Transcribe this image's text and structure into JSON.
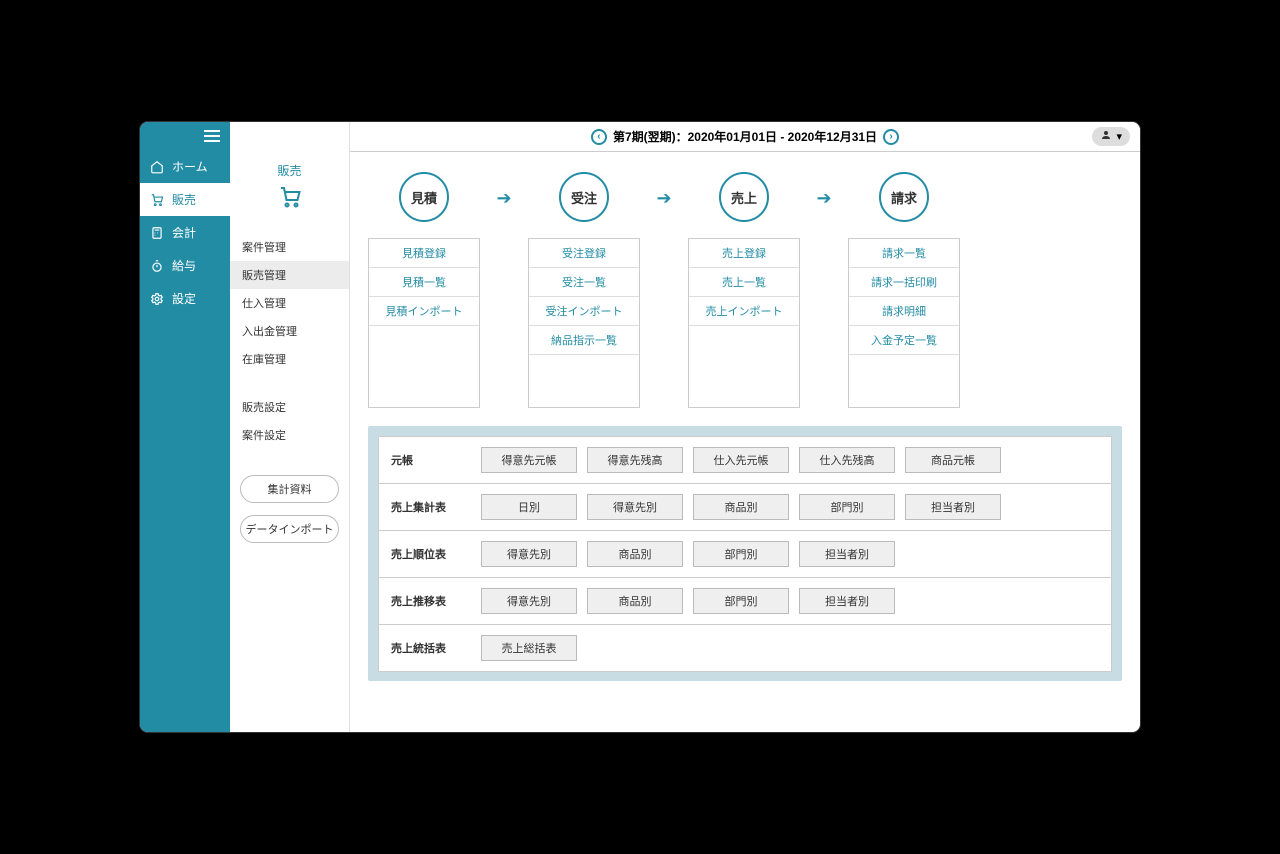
{
  "sidebar": {
    "items": [
      {
        "label": "ホーム",
        "icon": "home"
      },
      {
        "label": "販売",
        "icon": "cart",
        "active": true
      },
      {
        "label": "会計",
        "icon": "calc"
      },
      {
        "label": "給与",
        "icon": "clock"
      },
      {
        "label": "設定",
        "icon": "gear"
      }
    ]
  },
  "subnav": {
    "title": "販売",
    "items1": [
      "案件管理",
      "販売管理",
      "仕入管理",
      "入出金管理",
      "在庫管理"
    ],
    "active_index": 1,
    "items2": [
      "販売設定",
      "案件設定"
    ],
    "buttons": [
      "集計資料",
      "データインポート"
    ]
  },
  "topbar": {
    "period_label": "第7期(翌期)：2020年01月01日 - 2020年12月31日"
  },
  "flow": [
    {
      "title": "見積",
      "links": [
        "見積登録",
        "見積一覧",
        "見積インポート"
      ]
    },
    {
      "title": "受注",
      "links": [
        "受注登録",
        "受注一覧",
        "受注インポート",
        "納品指示一覧"
      ]
    },
    {
      "title": "売上",
      "links": [
        "売上登録",
        "売上一覧",
        "売上インポート"
      ]
    },
    {
      "title": "請求",
      "links": [
        "請求一覧",
        "請求一括印刷",
        "請求明細",
        "入金予定一覧"
      ]
    }
  ],
  "panel": [
    {
      "label": "元帳",
      "buttons": [
        "得意先元帳",
        "得意先残高",
        "仕入先元帳",
        "仕入先残高",
        "商品元帳"
      ]
    },
    {
      "label": "売上集計表",
      "buttons": [
        "日別",
        "得意先別",
        "商品別",
        "部門別",
        "担当者別"
      ]
    },
    {
      "label": "売上順位表",
      "buttons": [
        "得意先別",
        "商品別",
        "部門別",
        "担当者別"
      ]
    },
    {
      "label": "売上推移表",
      "buttons": [
        "得意先別",
        "商品別",
        "部門別",
        "担当者別"
      ]
    },
    {
      "label": "売上統括表",
      "buttons": [
        "売上総括表"
      ]
    }
  ]
}
